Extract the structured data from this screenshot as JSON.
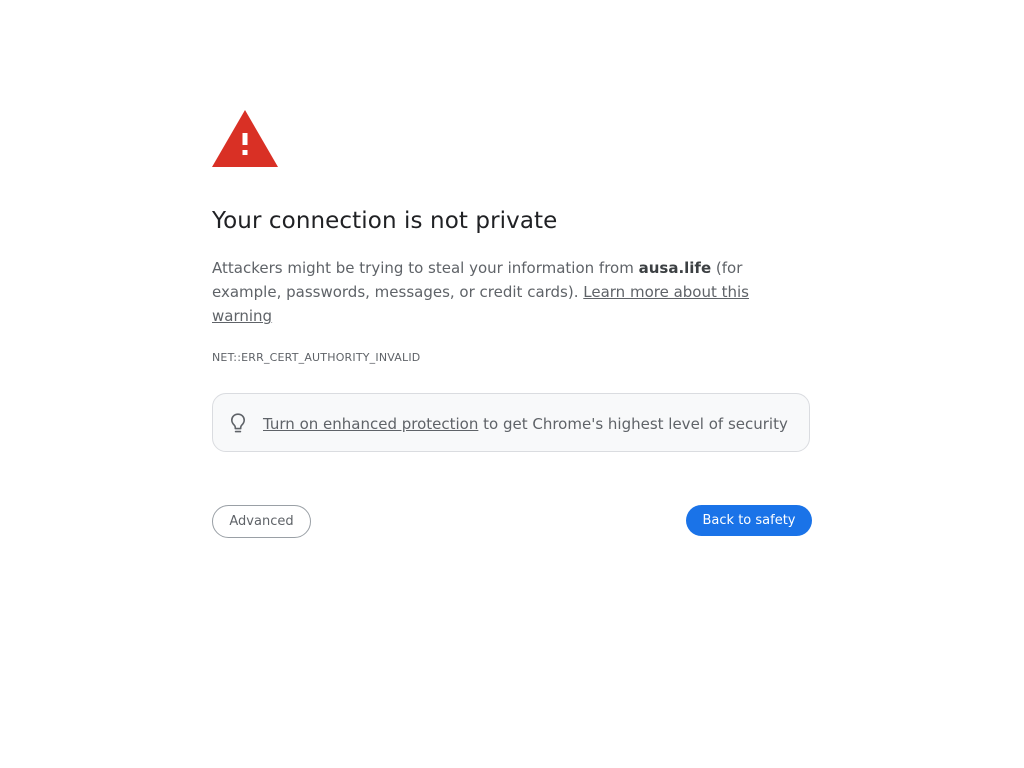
{
  "icons": {
    "warning": "warning-triangle-icon",
    "tip": "lightbulb-icon"
  },
  "colors": {
    "warning_red": "#d93025",
    "primary_blue": "#1a73e8",
    "text": "#202124",
    "secondary_text": "#5f6368"
  },
  "heading": "Your connection is not private",
  "explanation": {
    "before": "Attackers might be trying to steal your information from ",
    "domain": "ausa.life",
    "after": " (for example, passwords, messages, or credit cards). ",
    "learn_more": "Learn more about this warning"
  },
  "error_code": "NET::ERR_CERT_AUTHORITY_INVALID",
  "enhanced_protection": {
    "link": "Turn on enhanced protection",
    "text": " to get Chrome's highest level of security"
  },
  "buttons": {
    "advanced": "Advanced",
    "back_to_safety": "Back to safety"
  }
}
